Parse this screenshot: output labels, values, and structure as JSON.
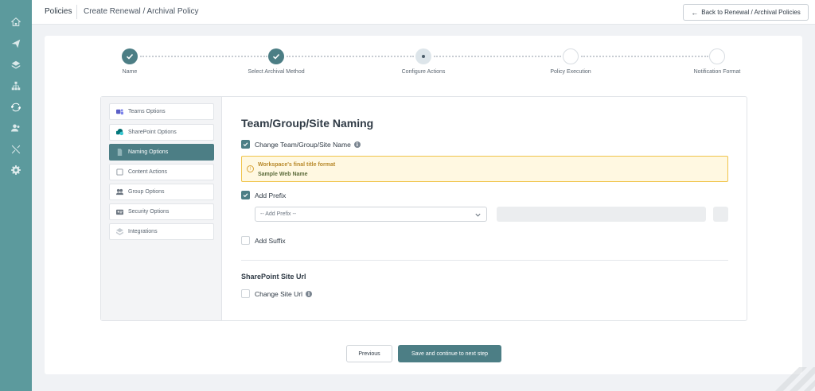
{
  "rail": {
    "icons": [
      "home-icon",
      "send-icon",
      "layers-icon",
      "org-chart-icon",
      "sync-icon",
      "users-icon",
      "tools-icon",
      "settings-icon"
    ],
    "active_icon": "sync-icon",
    "background": "#5c9a9d"
  },
  "header": {
    "root": "Policies",
    "page": "Create Renewal / Archival Policy",
    "back_label": "Back to Renewal / Archival Policies"
  },
  "stepper": {
    "steps": [
      {
        "label": "Name",
        "state": "done"
      },
      {
        "label": "Select Archival Method",
        "state": "done"
      },
      {
        "label": "Configure Actions",
        "state": "current"
      },
      {
        "label": "Policy Execution",
        "state": "todo"
      },
      {
        "label": "Notification Format",
        "state": "todo"
      }
    ]
  },
  "sidebar": {
    "items": [
      {
        "label": "Teams Options",
        "icon": "teams-icon",
        "active": false
      },
      {
        "label": "SharePoint Options",
        "icon": "sharepoint-icon",
        "active": false
      },
      {
        "label": "Naming Options",
        "icon": "document-icon",
        "active": true
      },
      {
        "label": "Content Actions",
        "icon": "content-icon",
        "active": false
      },
      {
        "label": "Group Options",
        "icon": "group-icon",
        "active": false
      },
      {
        "label": "Security Options",
        "icon": "id-card-icon",
        "active": false
      },
      {
        "label": "Integrations",
        "icon": "integrations-icon",
        "active": false
      }
    ]
  },
  "main": {
    "title": "Team/Group/Site Naming",
    "change_name": {
      "label": "Change Team/Group/Site Name",
      "checked": true
    },
    "notice": {
      "title": "Workspace's final title format",
      "value": "Sample Web Name"
    },
    "add_prefix": {
      "label": "Add Prefix",
      "checked": true
    },
    "prefix_select": {
      "value": "-- Add Prefix --"
    },
    "add_suffix": {
      "label": "Add Suffix",
      "checked": false
    },
    "sharepoint_title": "SharePoint Site Url",
    "change_site_url": {
      "label": "Change Site Url",
      "checked": false
    }
  },
  "footer": {
    "previous_label": "Previous",
    "next_label": "Save and continue to next step"
  },
  "colors": {
    "accent": "#4c7e85",
    "notice_border": "#f0c44a",
    "notice_bg": "#fff8e1"
  }
}
